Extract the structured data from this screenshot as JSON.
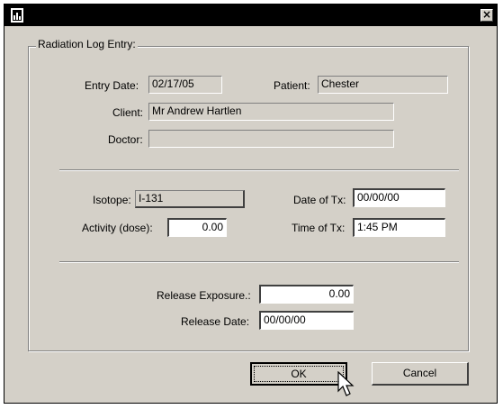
{
  "dialog": {
    "title": "",
    "group_label": "Radiation Log Entry:"
  },
  "fields": {
    "entry_date": {
      "label": "Entry Date:",
      "value": "02/17/05"
    },
    "patient": {
      "label": "Patient:",
      "value": "Chester"
    },
    "client": {
      "label": "Client:",
      "value": "Mr Andrew Hartlen"
    },
    "doctor": {
      "label": "Doctor:",
      "value": ""
    },
    "isotope": {
      "label": "Isotope:",
      "value": "I-131"
    },
    "activity": {
      "label": "Activity (dose):",
      "value": "0.00"
    },
    "date_of_tx": {
      "label": "Date of Tx:",
      "value": "00/00/00"
    },
    "time_of_tx": {
      "label": "Time of Tx:",
      "value": "1:45 PM"
    },
    "release_exposure": {
      "label": "Release Exposure.:",
      "value": "0.00"
    },
    "release_date": {
      "label": "Release Date:",
      "value": "00/00/00"
    }
  },
  "buttons": {
    "ok": "OK",
    "cancel": "Cancel"
  },
  "icons": {
    "app": "app-window-icon",
    "close": "close-icon",
    "cursor": "mouse-pointer-icon"
  }
}
